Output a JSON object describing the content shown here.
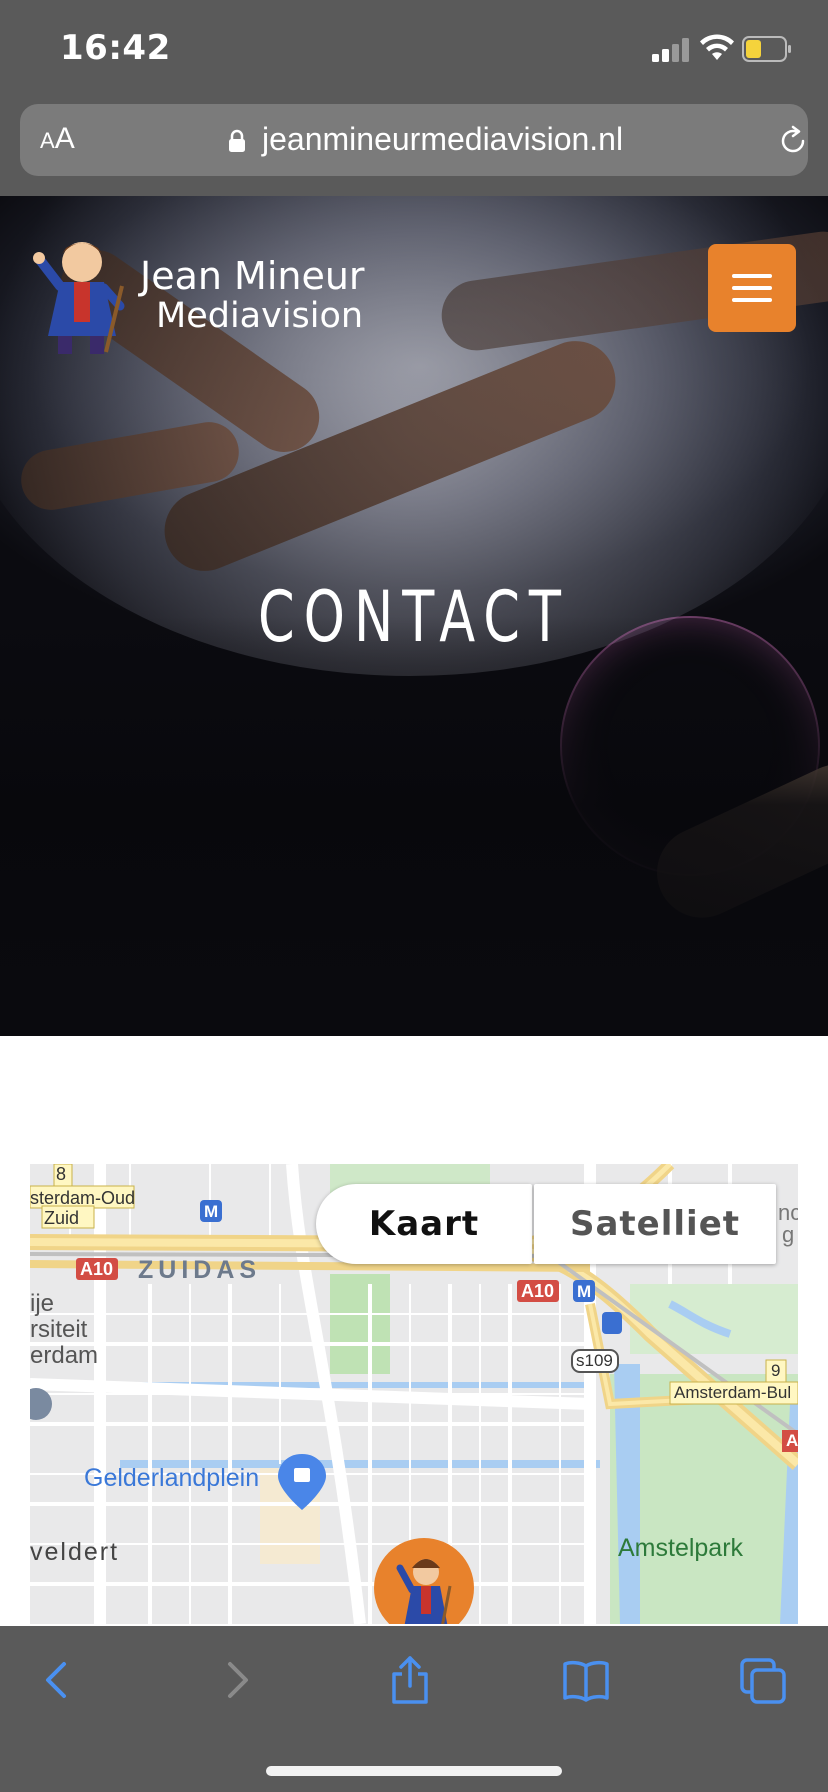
{
  "status_bar": {
    "time": "16:42",
    "signal_icon": "cellular-signal-icon",
    "wifi_icon": "wifi-icon",
    "battery_icon": "battery-icon",
    "battery_color": "#f5d33c"
  },
  "browser": {
    "text_size_button": {
      "small": "A",
      "large": "A"
    },
    "lock_icon": "lock-icon",
    "url": "jeanmineurmediavision.nl",
    "reload_icon": "reload-icon"
  },
  "site": {
    "logo": {
      "line1": "Jean Mineur",
      "line2": "Mediavision"
    },
    "menu_icon": "hamburger-menu-icon",
    "accent_color": "#e8822c",
    "hero_title": "CONTACT"
  },
  "map": {
    "toggle": {
      "map_label": "Kaart",
      "satellite_label": "Satelliet",
      "selected": "Kaart"
    },
    "labels": {
      "exit_8": "8",
      "amsterdam_oud_zuid": "sterdam-Oud",
      "zuid": "Zuid",
      "a10_left": "A10",
      "zuidas": "ZUIDAS",
      "a10_mid": "A10",
      "ije": "ije",
      "rsiteit": "rsiteit",
      "erdam": "erdam",
      "s109": "s109",
      "exit_9": "9",
      "amsterdam_bul": "Amsterdam-Bul",
      "gelderlandplein": "Gelderlandplein",
      "veldert": "veldert",
      "amstelpark": "Amstelpark",
      "edge_a": "A",
      "edge_nc": "nc",
      "edge_g": "g",
      "metro_1": "M",
      "metro_2": "M"
    },
    "pin_icon": "jean-mineur-mascot-pin-icon"
  },
  "toolbar": {
    "back_icon": "back-chevron-icon",
    "forward_icon": "forward-chevron-icon",
    "share_icon": "share-icon",
    "bookmarks_icon": "bookmarks-book-icon",
    "tabs_icon": "tabs-icon"
  }
}
